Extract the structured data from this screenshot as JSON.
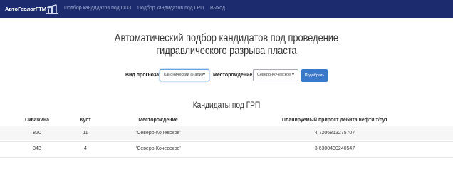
{
  "navbar": {
    "brand": "АвтоГеологГТМ",
    "logo_icon": "oil-pump-icon",
    "links": [
      "Подбор кандидатов под ОПЗ",
      "Подбор кандидатов под ГРП",
      "Выход"
    ]
  },
  "page": {
    "title_line1": "Автоматический подбор кандидатов под проведение",
    "title_line2": "гидравлического разрыва пласта"
  },
  "form": {
    "forecast_label": "Вид прогноза:",
    "forecast_value": "Канонический анализ",
    "field_label": "Месторождение:",
    "field_value": "Северо-Кочевское",
    "submit_label": "Подобрать"
  },
  "results": {
    "title": "Кандидаты под ГРП",
    "columns": [
      "Скважина",
      "Куст",
      "Месторождение",
      "Планируемый прирост дебита нефти т/сут"
    ],
    "rows": [
      {
        "well": "820",
        "bush": "11",
        "field": "'Северо-Кочевское'",
        "gain": "4.7206813275707"
      },
      {
        "well": "343",
        "bush": "4",
        "field": "'Северо-Кочевское'",
        "gain": "3.6300430240547"
      }
    ]
  },
  "colors": {
    "navbar_bg": "#1c2b6e",
    "accent_button": "#3a79c9"
  }
}
